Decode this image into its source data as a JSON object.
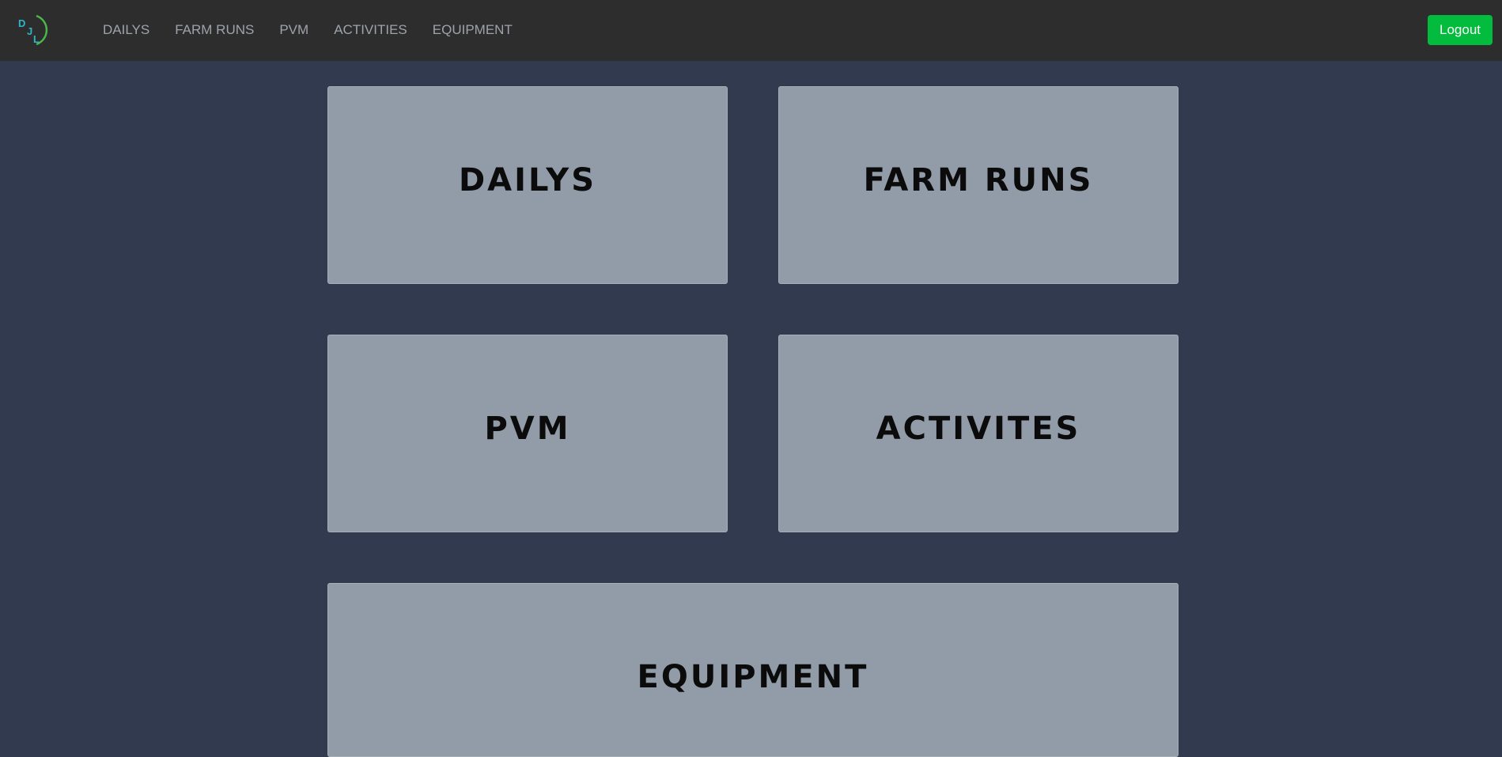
{
  "app": {
    "logo_icon": "djl-logo-icon",
    "logo_letters": [
      "D",
      "J",
      "L"
    ]
  },
  "nav": {
    "items": [
      {
        "label": "DAILYS"
      },
      {
        "label": "FARM RUNS"
      },
      {
        "label": "PVM"
      },
      {
        "label": "ACTIVITIES"
      },
      {
        "label": "EQUIPMENT"
      }
    ],
    "logout_label": "Logout"
  },
  "tiles": [
    {
      "label": "DAILYS"
    },
    {
      "label": "FARM RUNS"
    },
    {
      "label": "PVM"
    },
    {
      "label": "ACTIVITES"
    },
    {
      "label": "EQUIPMENT"
    }
  ],
  "colors": {
    "navbar_bg": "#2d2d2d",
    "page_bg": "#323a4f",
    "tile_bg": "#929ca8",
    "logout_bg": "#03bb3d",
    "logo_letter": "#2fb5c9",
    "logo_arc": "#4cb748"
  }
}
